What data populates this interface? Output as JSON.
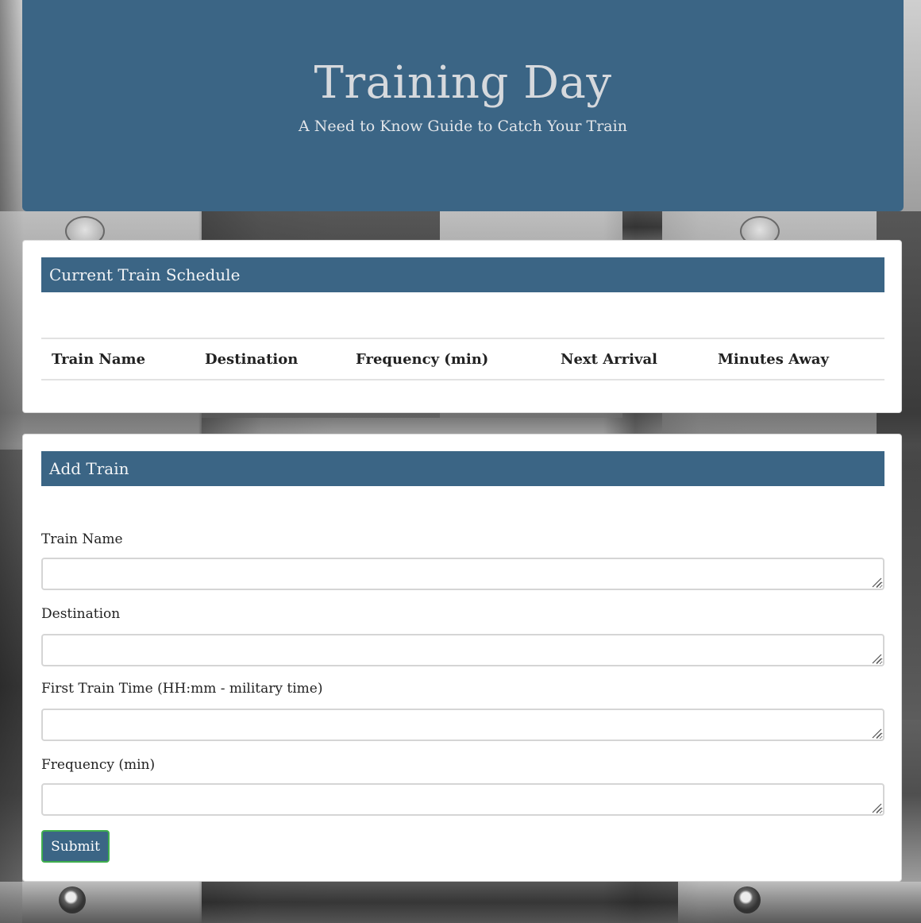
{
  "header": {
    "title": "Training Day",
    "subtitle": "A Need to Know Guide to Catch Your Train"
  },
  "schedule": {
    "heading": "Current Train Schedule",
    "columns": [
      "Train Name",
      "Destination",
      "Frequency (min)",
      "Next Arrival",
      "Minutes Away"
    ],
    "rows": []
  },
  "add_train": {
    "heading": "Add Train",
    "fields": [
      {
        "label": "Train Name",
        "value": ""
      },
      {
        "label": "Destination",
        "value": ""
      },
      {
        "label": "First Train Time (HH:mm - military time)",
        "value": ""
      },
      {
        "label": "Frequency (min)",
        "value": ""
      }
    ],
    "submit_label": "Submit"
  },
  "colors": {
    "primary": "#3b6585",
    "panel_background": "#ffffff",
    "submit_border": "#3fae4e"
  }
}
